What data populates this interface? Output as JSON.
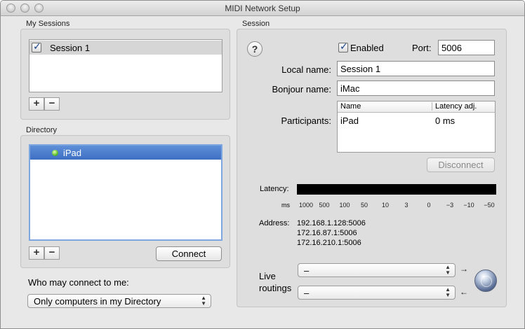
{
  "window": {
    "title": "MIDI Network Setup"
  },
  "my_sessions": {
    "label": "My Sessions",
    "items": [
      {
        "name": "Session 1",
        "checked": true
      }
    ],
    "add_label": "+",
    "remove_label": "−"
  },
  "directory": {
    "label": "Directory",
    "items": [
      {
        "name": "iPad",
        "status_color": "#58c02a"
      }
    ],
    "add_label": "+",
    "remove_label": "−",
    "connect_label": "Connect"
  },
  "who_may_connect": {
    "label": "Who may connect to me:",
    "selected": "Only computers in my Directory"
  },
  "session": {
    "label": "Session",
    "help_label": "?",
    "enabled_label": "Enabled",
    "enabled": true,
    "port_label": "Port:",
    "port_value": "5006",
    "local_name_label": "Local name:",
    "local_name_value": "Session 1",
    "bonjour_name_label": "Bonjour name:",
    "bonjour_name_value": "iMac",
    "participants_label": "Participants:",
    "participants_columns": [
      "Name",
      "Latency adj."
    ],
    "participants_rows": [
      [
        "iPad",
        "0 ms"
      ]
    ],
    "disconnect_label": "Disconnect",
    "latency_label": "Latency:",
    "latency_unit": "ms",
    "latency_ticks": [
      "1000",
      "500",
      "100",
      "50",
      "10",
      "3",
      "0",
      "−3",
      "−10",
      "−50"
    ],
    "address_label": "Address:",
    "addresses": [
      "192.168.1.128:5006",
      "172.16.87.1:5006",
      "172.16.210.1:5006"
    ],
    "live_routings_label_1": "Live",
    "live_routings_label_2": "routings",
    "routing_in_selected": "–",
    "routing_out_selected": "–",
    "arrow_right": "→",
    "arrow_left": "←"
  },
  "colors": {
    "selection_blue": "#3e6fc4",
    "selection_grey": "#d6d6d6",
    "window_bg": "#e8e8e8"
  }
}
